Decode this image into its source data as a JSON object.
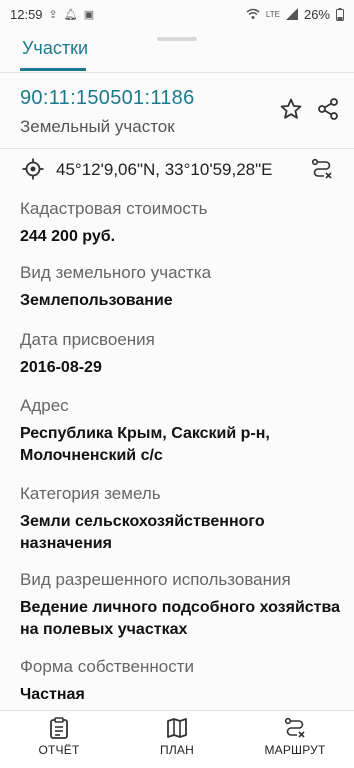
{
  "status_bar": {
    "time": "12:59",
    "battery": "26%",
    "notification_icons": [
      "upload-icon",
      "bell-icon",
      "gallery-icon"
    ],
    "system_icons": [
      "wifi-icon",
      "volte-icon",
      "signal-icon",
      "battery-icon"
    ]
  },
  "header": {
    "tab_label": "Участки"
  },
  "parcel": {
    "number": "90:11:150501:1186",
    "type": "Земельный участок"
  },
  "coordinates": "45°12'9,06\"N, 33°10'59,28\"E",
  "fields": [
    {
      "label": "Кадастровая стоимость",
      "value": "244 200 руб."
    },
    {
      "label": "Вид земельного участка",
      "value": "Землепользование"
    },
    {
      "label": "Дата присвоения",
      "value": "2016-08-29"
    },
    {
      "label": "Адрес",
      "value": [
        "Республика Крым, Сакский р-н,",
        "Молочненский с/с"
      ]
    },
    {
      "label": "Категория земель",
      "value": [
        "Земли сельскохозяйственного",
        "назначения"
      ]
    },
    {
      "label": "Вид разрешенного использования",
      "value": [
        "Ведение личного подсобного хозяйства",
        "на полевых участках"
      ]
    },
    {
      "label": "Форма собственности",
      "value": "Частная"
    }
  ],
  "bottom_nav": {
    "report": "ОТЧЁТ",
    "plan": "ПЛАН",
    "route": "МАРШРУТ"
  },
  "colors": {
    "accent": "#1c7a8c",
    "text": "#222222",
    "muted": "#666666"
  }
}
